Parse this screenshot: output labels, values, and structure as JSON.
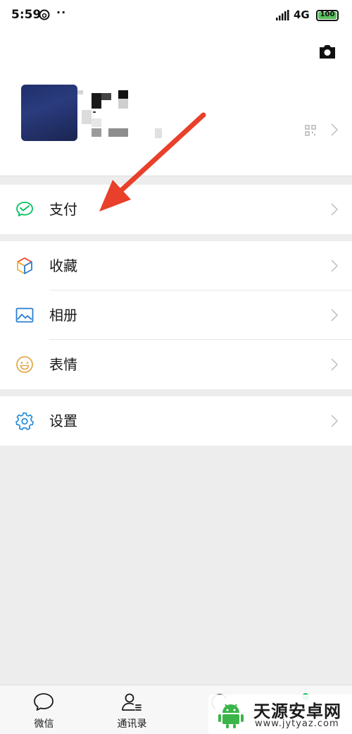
{
  "status_bar": {
    "time": "5:59",
    "dots": "··",
    "network": "4G",
    "battery": "100"
  },
  "colors": {
    "pay_green": "#07c160",
    "arrow_red": "#e8402a",
    "settings_blue": "#1e88d8",
    "emoji_orange": "#e3a94a",
    "album_blue": "#2b7fcf",
    "battery_green": "#58c15c"
  },
  "menu": {
    "group1": [
      {
        "label": "支付",
        "icon": "pay-icon"
      }
    ],
    "group2": [
      {
        "label": "收藏",
        "icon": "favorites-cube-icon"
      },
      {
        "label": "相册",
        "icon": "album-picture-icon"
      },
      {
        "label": "表情",
        "icon": "sticker-smile-icon"
      }
    ],
    "group3": [
      {
        "label": "设置",
        "icon": "settings-gear-icon"
      }
    ]
  },
  "tabs": [
    {
      "label": "微信",
      "icon": "chat-bubble-icon"
    },
    {
      "label": "通讯录",
      "icon": "contacts-icon"
    }
  ],
  "watermark": {
    "title": "天源安卓网",
    "url": "www.jytyaz.com"
  }
}
